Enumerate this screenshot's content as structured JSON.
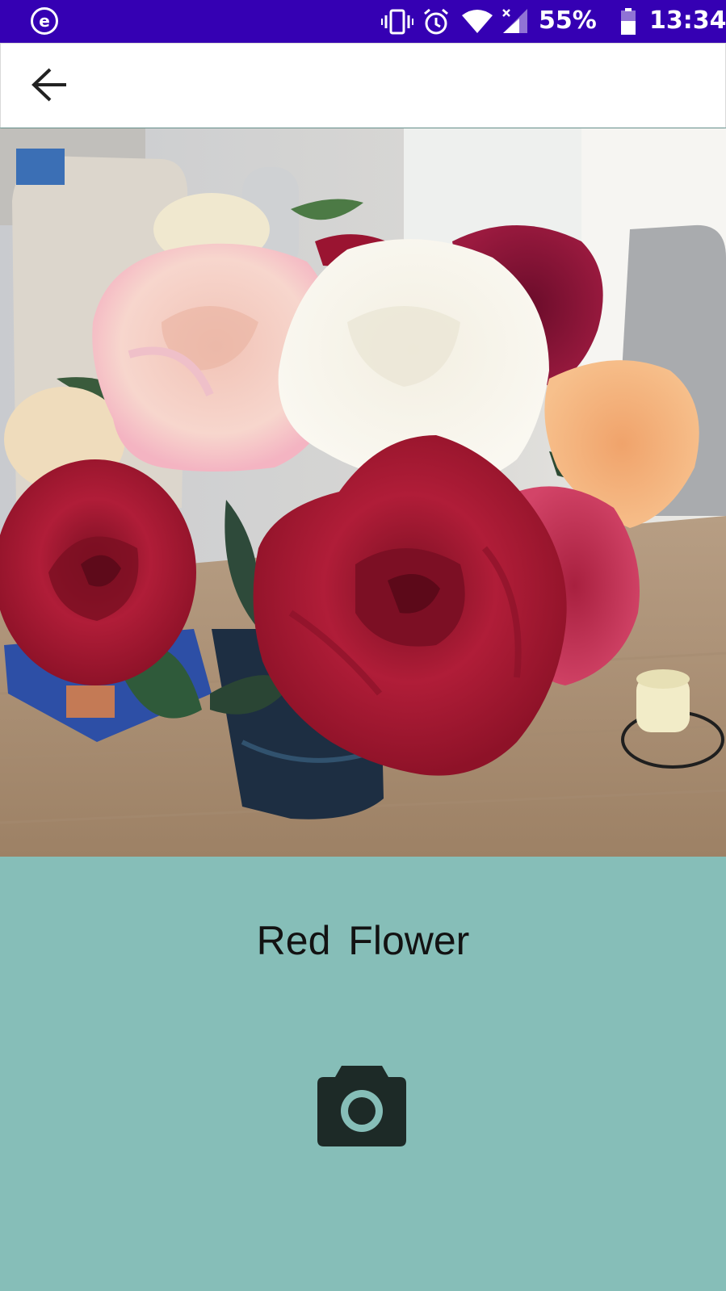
{
  "status_bar": {
    "app_badge": "e",
    "battery_percent": "55%",
    "time": "13:34",
    "icons": [
      "vibrate-icon",
      "alarm-icon",
      "wifi-icon",
      "cell-signal-icon",
      "battery-icon"
    ],
    "color": "#3500b3"
  },
  "toolbar": {
    "back_icon": "arrow-left-icon"
  },
  "photo": {
    "subject": "bouquet of roses in a vase"
  },
  "result": {
    "label": "Red Flower"
  },
  "actions": {
    "camera_icon": "camera-icon"
  },
  "colors": {
    "background": "#86beb8",
    "status_bar": "#3500b3",
    "toolbar": "#ffffff",
    "icon_dark": "#1d2a27"
  }
}
